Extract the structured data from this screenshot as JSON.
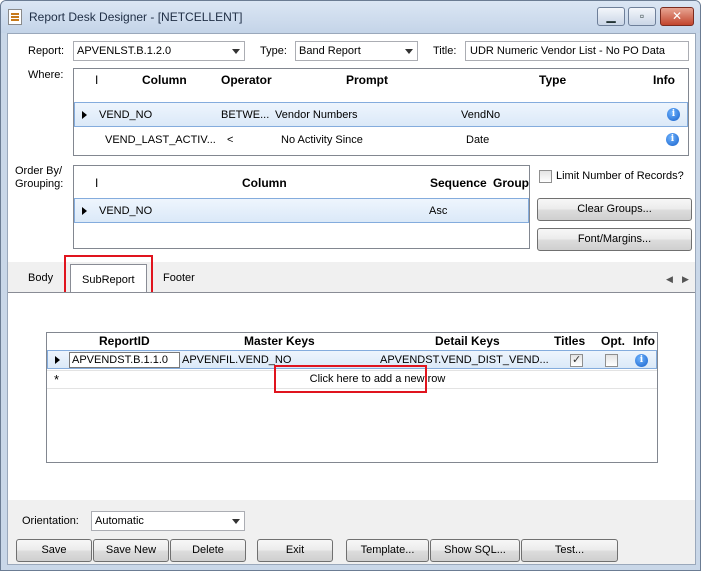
{
  "window": {
    "title": "Report Desk Designer - [NETCELLENT]"
  },
  "header": {
    "report_label": "Report:",
    "report_value": "APVENLST.B.1.2.0",
    "type_label": "Type:",
    "type_value": "Band Report",
    "title_label": "Title:",
    "title_value": "UDR Numeric Vendor List - No PO Data"
  },
  "where": {
    "label": "Where:",
    "columns": {
      "i": "I",
      "column": "Column",
      "operator": "Operator",
      "prompt": "Prompt",
      "type": "Type",
      "info": "Info"
    },
    "rows": [
      {
        "column": "VEND_NO",
        "operator": "BETWE...",
        "prompt": "Vendor Numbers",
        "type": "VendNo"
      },
      {
        "column": "VEND_LAST_ACTIV...",
        "operator": "<",
        "prompt": "No Activity Since",
        "type": "Date"
      }
    ]
  },
  "order_by": {
    "label_line1": "Order By/",
    "label_line2": "Grouping:",
    "columns": {
      "i": "I",
      "column": "Column",
      "sequence": "Sequence",
      "group": "Group"
    },
    "rows": [
      {
        "column": "VEND_NO",
        "sequence": "Asc"
      }
    ]
  },
  "side": {
    "limit_label": "Limit Number of Records?",
    "clear_groups": "Clear Groups...",
    "font_margins": "Font/Margins..."
  },
  "tabs": [
    {
      "label": "Body"
    },
    {
      "label": "SubReport"
    },
    {
      "label": "Footer"
    }
  ],
  "subreport": {
    "columns": {
      "report_id": "ReportID",
      "master_keys": "Master Keys",
      "detail_keys": "Detail Keys",
      "titles": "Titles",
      "opt": "Opt.",
      "info": "Info"
    },
    "rows": [
      {
        "report_id": "APVENDST.B.1.1.0",
        "master_keys": "APVENFIL.VEND_NO",
        "detail_keys": "APVENDST.VEND_DIST_VEND...",
        "titles": true,
        "opt": false
      }
    ],
    "new_row_marker": "*",
    "new_row_text": "Click here to add a new row"
  },
  "footer": {
    "orientation_label": "Orientation:",
    "orientation_value": "Automatic",
    "buttons": {
      "save": "Save",
      "save_new": "Save New",
      "delete": "Delete",
      "exit": "Exit",
      "template": "Template...",
      "show_sql": "Show SQL...",
      "test": "Test..."
    }
  },
  "colors": {
    "highlight": "#e0141e",
    "selection": "#dbe9f8",
    "info": "#1760c9"
  },
  "icons": {
    "info": "info-icon",
    "row": "row-pointer-icon",
    "app": "report-app-icon"
  }
}
